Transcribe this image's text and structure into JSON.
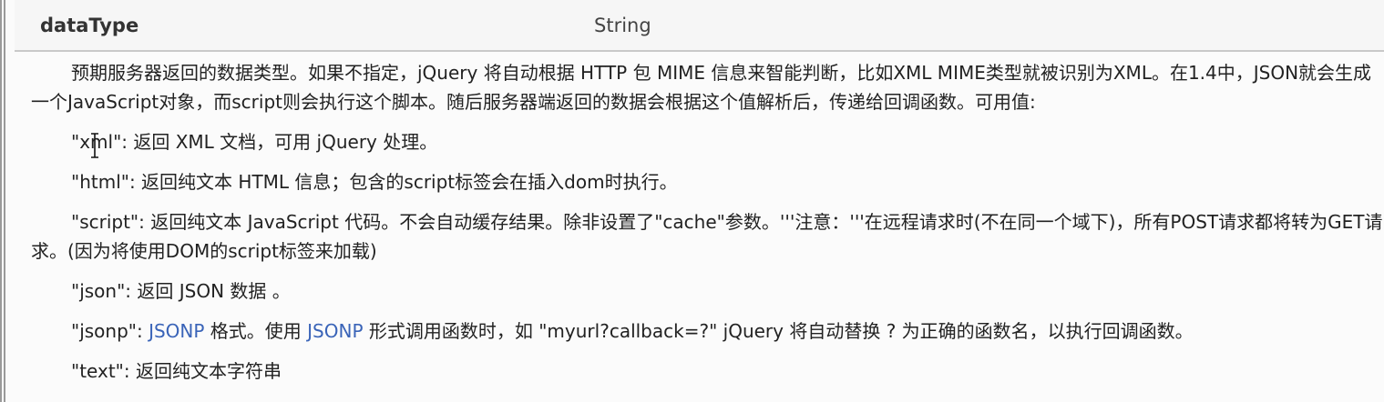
{
  "param": {
    "name": "dataType",
    "type": "String"
  },
  "description": {
    "intro": "预期服务器返回的数据类型。如果不指定，jQuery 将自动根据 HTTP 包 MIME 信息来智能判断，比如XML MIME类型就被识别为XML。在1.4中，JSON就会生成一个JavaScript对象，而script则会执行这个脚本。随后服务器端返回的数据会根据这个值解析后，传递给回调函数。可用值:",
    "options": {
      "xml": "\"xml\": 返回 XML 文档，可用 jQuery 处理。",
      "html": "\"html\": 返回纯文本 HTML 信息；包含的script标签会在插入dom时执行。",
      "script": "\"script\": 返回纯文本 JavaScript 代码。不会自动缓存结果。除非设置了\"cache\"参数。'''注意：'''在远程请求时(不在同一个域下)，所有POST请求都将转为GET请求。(因为将使用DOM的script标签来加载)",
      "json": "\"json\": 返回 JSON 数据 。",
      "jsonp_prefix": "\"jsonp\": ",
      "jsonp_link1": "JSONP",
      "jsonp_mid": " 格式。使用 ",
      "jsonp_link2": "JSONP",
      "jsonp_suffix": " 形式调用函数时，如 \"myurl?callback=?\" jQuery 将自动替换 ? 为正确的函数名，以执行回调函数。",
      "text": "\"text\": 返回纯文本字符串"
    }
  },
  "colors": {
    "link": "#3a64b8",
    "text": "#222222",
    "border": "#c9c9c9"
  },
  "icons": {
    "cursor": "text-cursor-icon"
  }
}
